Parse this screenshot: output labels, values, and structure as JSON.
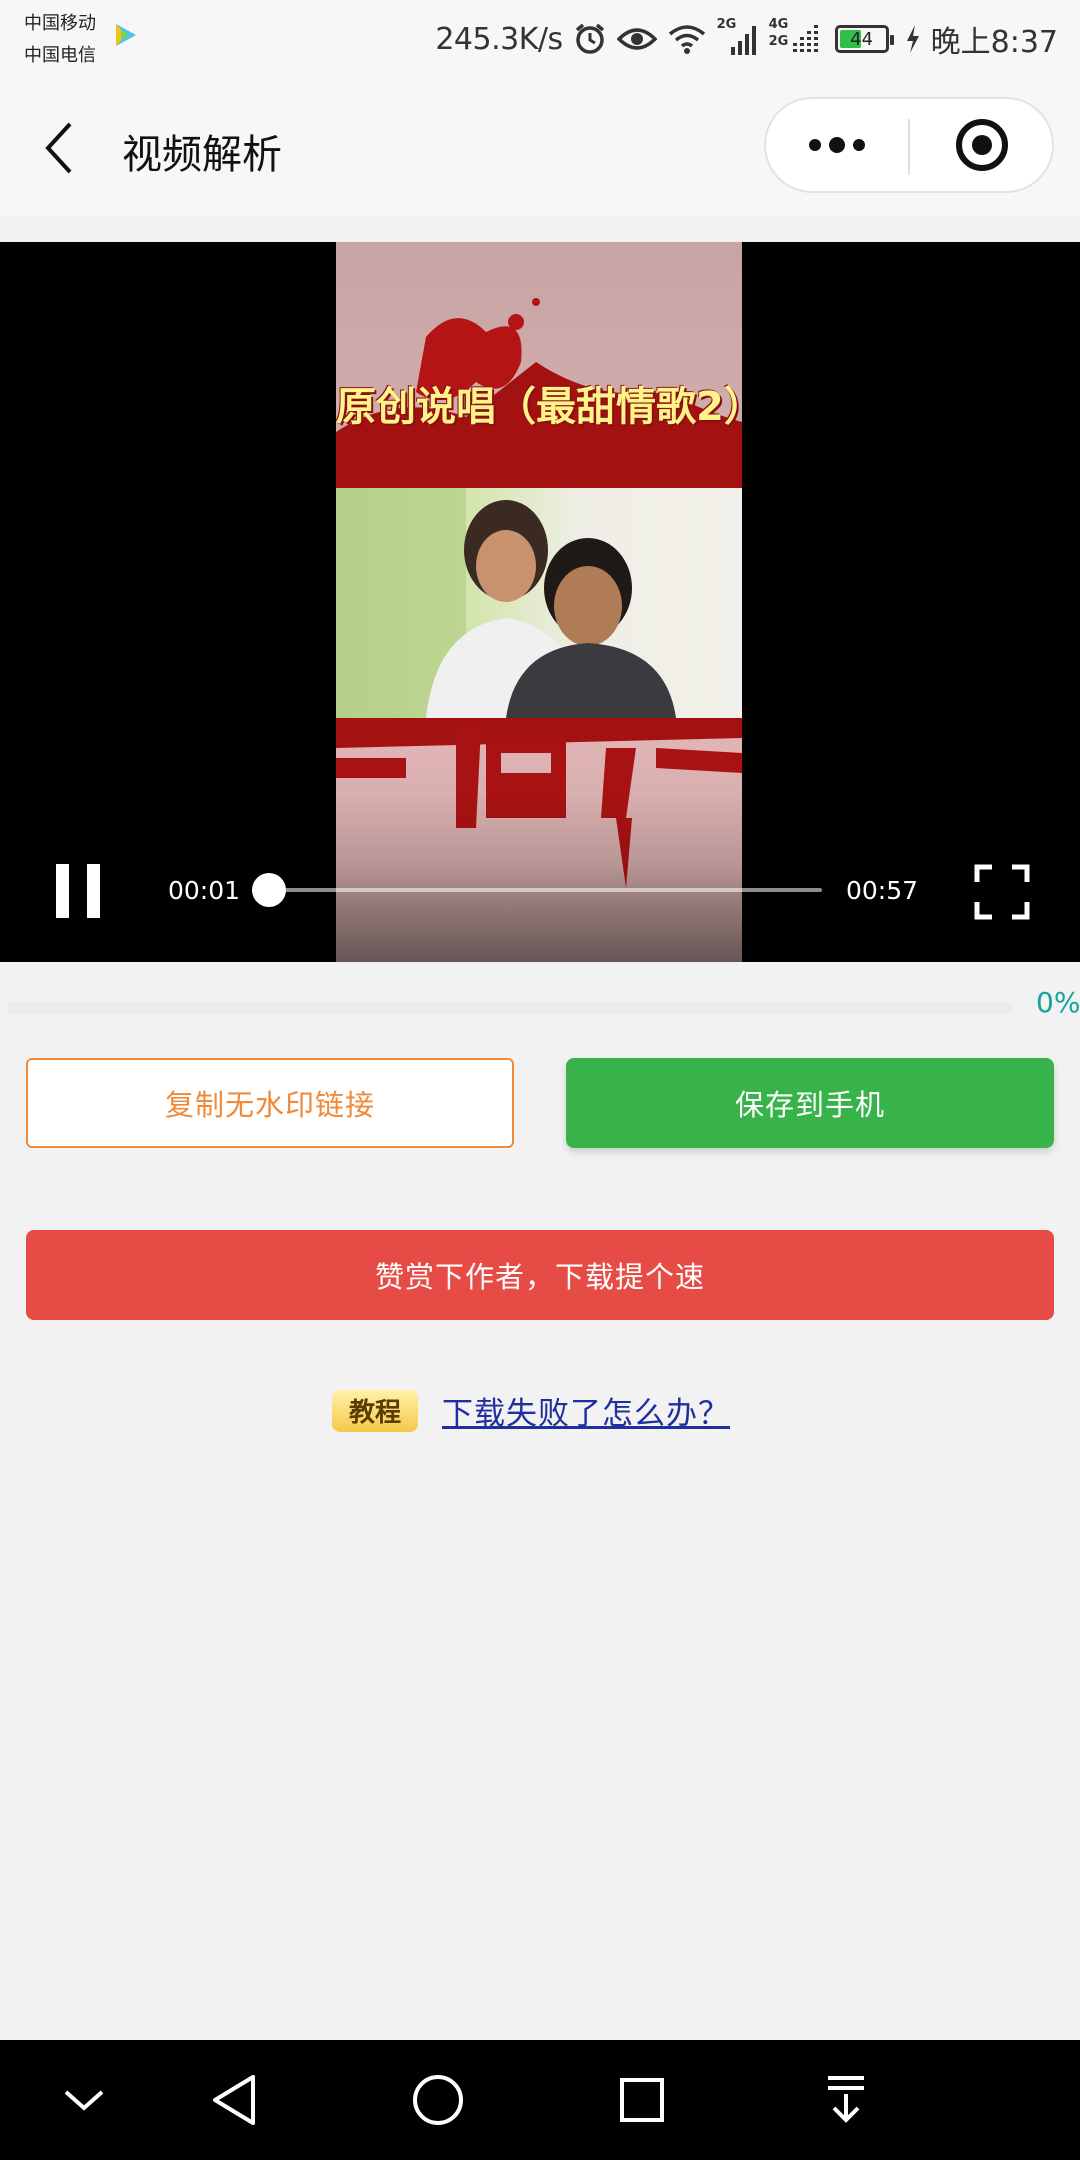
{
  "status_bar": {
    "carrier_1": "中国移动",
    "carrier_2": "中国电信",
    "net_speed": "245.3K/s",
    "signal_1_label": "2G",
    "signal_2_label_top": "4G",
    "signal_2_label_bottom": "2G",
    "battery_level": "44",
    "time": "晚上8:37"
  },
  "navbar": {
    "title": "视频解析"
  },
  "player": {
    "video_title": "原创说唱（最甜情歌2）",
    "current_time": "00:01",
    "total_time": "00:57",
    "progress_fraction": 0.03
  },
  "download": {
    "percent_label": "0%",
    "progress_fraction": 0
  },
  "actions": {
    "copy_label": "复制无水印链接",
    "save_label": "保存到手机",
    "tip_label": "赞赏下作者，下载提个速"
  },
  "tutorial": {
    "badge": "教程",
    "link_text": "下载失败了怎么办？"
  },
  "colors": {
    "save_green": "#38b349",
    "copy_orange": "#ef8a3a",
    "tip_red": "#e64c45",
    "percent_teal": "#19a29a"
  },
  "icons": {
    "status": [
      "alarm-icon",
      "eye-icon",
      "wifi-icon",
      "signal-icon",
      "battery-icon",
      "charging-icon"
    ],
    "navbar": [
      "back-chevron-icon",
      "more-dots-icon",
      "close-target-icon"
    ],
    "player": [
      "pause-icon",
      "fullscreen-icon"
    ],
    "system_nav": [
      "collapse-icon",
      "back-triangle-icon",
      "home-circle-icon",
      "recents-square-icon",
      "notification-pulldown-icon"
    ]
  }
}
